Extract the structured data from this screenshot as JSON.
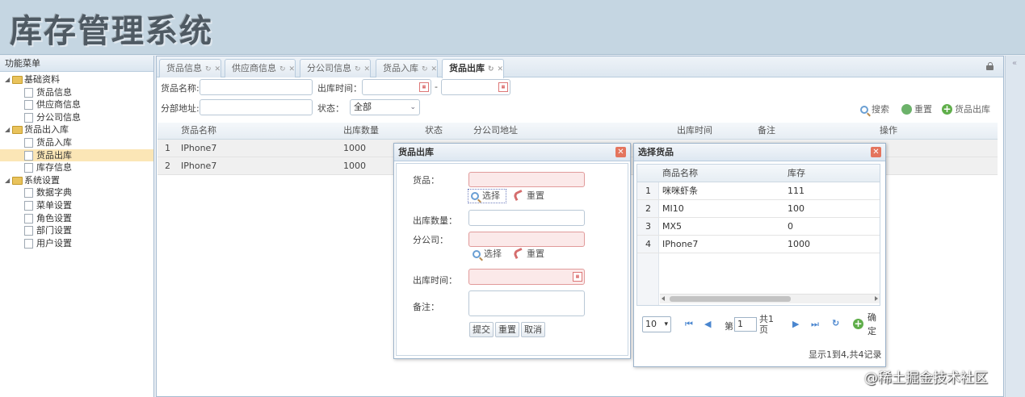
{
  "app": {
    "title": "库存管理系统"
  },
  "sidebar": {
    "title": "功能菜单",
    "groups": [
      {
        "label": "基础资料",
        "items": [
          "货品信息",
          "供应商信息",
          "分公司信息"
        ]
      },
      {
        "label": "货品出入库",
        "items": [
          "货品入库",
          "货品出库",
          "库存信息"
        ]
      },
      {
        "label": "系统设置",
        "items": [
          "数据字典",
          "菜单设置",
          "角色设置",
          "部门设置",
          "用户设置"
        ]
      }
    ],
    "active_item": "货品出库"
  },
  "tabs": [
    {
      "label": "货品信息"
    },
    {
      "label": "供应商信息"
    },
    {
      "label": "分公司信息"
    },
    {
      "label": "货品入库"
    },
    {
      "label": "货品出库",
      "active": true
    }
  ],
  "filters": {
    "product_name_label": "货品名称:",
    "out_time_label": "出库时间：",
    "range_sep": "-",
    "branch_address_label": "分部地址:",
    "status_label": "状态：",
    "status_value": "全部"
  },
  "toolbar": {
    "search": "搜索",
    "reset": "重置",
    "outbound": "货品出库"
  },
  "grid": {
    "columns": [
      "货品名称",
      "出库数量",
      "状态",
      "分公司地址",
      "出库时间",
      "备注",
      "操作"
    ],
    "rows": [
      {
        "n": "1",
        "name": "IPhone7",
        "qty": "1000"
      },
      {
        "n": "2",
        "name": "IPhone7",
        "qty": "1000"
      }
    ]
  },
  "outbound_dialog": {
    "title": "货品出库",
    "goods_label": "货品：",
    "select_label": "选择",
    "reset_label": "重置",
    "qty_label": "出库数量：",
    "branch_label": "分公司：",
    "time_label": "出库时间：",
    "remark_label": "备注：",
    "submit": "提交",
    "reset": "重置",
    "cancel": "取消"
  },
  "picker_dialog": {
    "title": "选择货品",
    "columns": [
      "商品名称",
      "库存"
    ],
    "rows": [
      {
        "n": "1",
        "name": "咪咪虾条",
        "stock": "111"
      },
      {
        "n": "2",
        "name": "MI10",
        "stock": "100"
      },
      {
        "n": "3",
        "name": "MX5",
        "stock": "0"
      },
      {
        "n": "4",
        "name": "IPhone7",
        "stock": "1000"
      }
    ],
    "page_size": "10",
    "page_prefix": "第",
    "page_value": "1",
    "page_total": "共1页",
    "confirm": "确定",
    "summary": "显示1到4,共4记录"
  },
  "watermark": "@稀土掘金技术社区",
  "colors": {
    "header_bg": "#c5d6e2",
    "active_tree": "#fbe6b6",
    "error_border": "#e19b9b",
    "accent_blue": "#4a86cf"
  }
}
